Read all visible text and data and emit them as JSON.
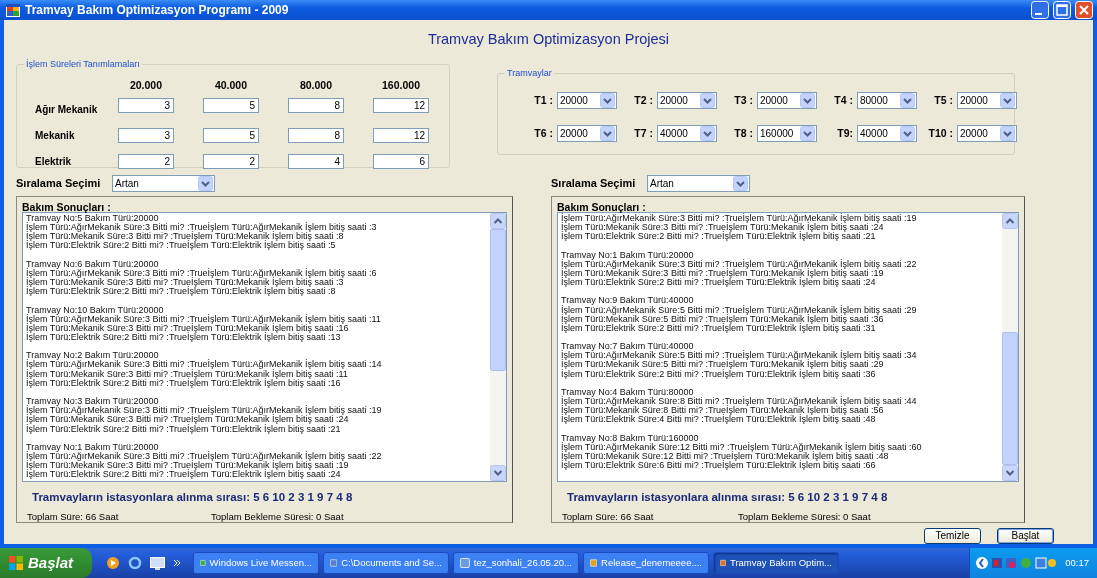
{
  "window": {
    "title": "Tramvay Bakım Optimizasyon Programı - 2009"
  },
  "heading": "Tramvay Bakım Optimizasyon Projesi",
  "durations": {
    "legend": "İşlem Süreleri  Tanımlamaları",
    "columns": [
      "20.000",
      "40.000",
      "80.000",
      "160.000"
    ],
    "rows": [
      {
        "label": "Ağır Mekanik",
        "values": [
          "3",
          "5",
          "8",
          "12"
        ]
      },
      {
        "label": "Mekanik",
        "values": [
          "3",
          "5",
          "8",
          "12"
        ]
      },
      {
        "label": "Elektrik",
        "values": [
          "2",
          "2",
          "4",
          "6"
        ]
      }
    ]
  },
  "trams": {
    "legend": "Tramvaylar",
    "items": [
      {
        "label": "T1 :",
        "value": "20000"
      },
      {
        "label": "T2 :",
        "value": "20000"
      },
      {
        "label": "T3 :",
        "value": "20000"
      },
      {
        "label": "T4 :",
        "value": "80000"
      },
      {
        "label": "T5 :",
        "value": "20000"
      },
      {
        "label": "T6 :",
        "value": "20000"
      },
      {
        "label": "T7 :",
        "value": "40000"
      },
      {
        "label": "T8 :",
        "value": "160000"
      },
      {
        "label": "T9:",
        "value": "40000"
      },
      {
        "label": "T10 :",
        "value": "20000"
      }
    ]
  },
  "panels": [
    {
      "sort_label": "Sıralama Seçimi",
      "sort_value": "Artan",
      "results_title": "Bakım Sonuçları :",
      "blocks": [
        {
          "header": "Tramvay No:5 Bakım Türü:20000",
          "lines": [
            "İşlem Türü:AğırMekanik Süre:3 Bitti mi? :Trueİşlem Türü:AğırMekanik İşlem bitiş saati :3",
            "İşlem Türü:Mekanik Süre:3 Bitti mi? :Trueİşlem Türü:Mekanik İşlem bitiş saati :8",
            "İşlem Türü:Elektrik Süre:2 Bitti mi? :Trueİşlem Türü:Elektrik İşlem bitiş saati :5"
          ]
        },
        {
          "header": "Tramvay No:6 Bakım Türü:20000",
          "lines": [
            "İşlem Türü:AğırMekanik Süre:3 Bitti mi? :Trueİşlem Türü:AğırMekanik İşlem bitiş saati :6",
            "İşlem Türü:Mekanik Süre:3 Bitti mi? :Trueİşlem Türü:Mekanik İşlem bitiş saati :3",
            "İşlem Türü:Elektrik Süre:2 Bitti mi? :Trueİşlem Türü:Elektrik İşlem bitiş saati :8"
          ]
        },
        {
          "header": "Tramvay No:10 Bakım Türü:20000",
          "lines": [
            "İşlem Türü:AğırMekanik Süre:3 Bitti mi? :Trueİşlem Türü:AğırMekanik İşlem bitiş saati :11",
            "İşlem Türü:Mekanik Süre:3 Bitti mi? :Trueİşlem Türü:Mekanik İşlem bitiş saati :16",
            "İşlem Türü:Elektrik Süre:2 Bitti mi? :Trueİşlem Türü:Elektrik İşlem bitiş saati :13"
          ]
        },
        {
          "header": "Tramvay No:2 Bakım Türü:20000",
          "lines": [
            "İşlem Türü:AğırMekanik Süre:3 Bitti mi? :Trueİşlem Türü:AğırMekanik İşlem bitiş saati :14",
            "İşlem Türü:Mekanik Süre:3 Bitti mi? :Trueİşlem Türü:Mekanik İşlem bitiş saati :11",
            "İşlem Türü:Elektrik Süre:2 Bitti mi? :Trueİşlem Türü:Elektrik İşlem bitiş saati :16"
          ]
        },
        {
          "header": "Tramvay No:3 Bakım Türü:20000",
          "lines": [
            "İşlem Türü:AğırMekanik Süre:3 Bitti mi? :Trueİşlem Türü:AğırMekanik İşlem bitiş saati :19",
            "İşlem Türü:Mekanik Süre:3 Bitti mi? :Trueİşlem Türü:Mekanik İşlem bitiş saati :24",
            "İşlem Türü:Elektrik Süre:2 Bitti mi? :Trueİşlem Türü:Elektrik İşlem bitiş saati :21"
          ]
        },
        {
          "header": "Tramvay No:1 Bakım Türü:20000",
          "lines": [
            "İşlem Türü:AğırMekanik Süre:3 Bitti mi? :Trueİşlem Türü:AğırMekanik İşlem bitiş saati :22",
            "İşlem Türü:Mekanik Süre:3 Bitti mi? :Trueİşlem Türü:Mekanik İşlem bitiş saati :19",
            "İşlem Türü:Elektrik Süre:2 Bitti mi? :Trueİşlem Türü:Elektrik İşlem bitiş saati :24"
          ]
        }
      ],
      "order": "Tramvayların istasyonlara alınma sırası: 5 6 10 2 3 1 9 7 4 8",
      "total": "Toplam Süre: 66 Saat",
      "wait": "Toplam Bekleme Süresi: 0 Saat"
    },
    {
      "sort_label": "Sıralama Seçimi",
      "sort_value": "Artan",
      "results_title": "Bakım Sonuçları :",
      "blocks": [
        {
          "lines": [
            "İşlem Türü:AğırMekanik Süre:3 Bitti mi? :Trueİşlem Türü:AğırMekanik İşlem bitiş saati :19",
            "İşlem Türü:Mekanik Süre:3 Bitti mi? :Trueİşlem Türü:Mekanik İşlem bitiş saati :24",
            "İşlem Türü:Elektrik Süre:2 Bitti mi? :Trueİşlem Türü:Elektrik İşlem bitiş saati :21"
          ]
        },
        {
          "header": "Tramvay No:1 Bakım Türü:20000",
          "lines": [
            "İşlem Türü:AğırMekanik Süre:3 Bitti mi? :Trueİşlem Türü:AğırMekanik İşlem bitiş saati :22",
            "İşlem Türü:Mekanik Süre:3 Bitti mi? :Trueİşlem Türü:Mekanik İşlem bitiş saati :19",
            "İşlem Türü:Elektrik Süre:2 Bitti mi? :Trueİşlem Türü:Elektrik İşlem bitiş saati :24"
          ]
        },
        {
          "header": "Tramvay No:9 Bakım Türü:40000",
          "lines": [
            "İşlem Türü:AğırMekanik Süre:5 Bitti mi? :Trueİşlem Türü:AğırMekanik İşlem bitiş saati :29",
            "İşlem Türü:Mekanik Süre:5 Bitti mi? :Trueİşlem Türü:Mekanik İşlem bitiş saati :36",
            "İşlem Türü:Elektrik Süre:2 Bitti mi? :Trueİşlem Türü:Elektrik İşlem bitiş saati :31"
          ]
        },
        {
          "header": "Tramvay No:7 Bakım Türü:40000",
          "lines": [
            "İşlem Türü:AğırMekanik Süre:5 Bitti mi? :Trueİşlem Türü:AğırMekanik İşlem bitiş saati :34",
            "İşlem Türü:Mekanik Süre:5 Bitti mi? :Trueİşlem Türü:Mekanik İşlem bitiş saati :29",
            "İşlem Türü:Elektrik Süre:2 Bitti mi? :Trueİşlem Türü:Elektrik İşlem bitiş saati :36"
          ]
        },
        {
          "header": "Tramvay No:4 Bakım Türü:80000",
          "lines": [
            "İşlem Türü:AğırMekanik Süre:8 Bitti mi? :Trueİşlem Türü:AğırMekanik İşlem bitiş saati :44",
            "İşlem Türü:Mekanik Süre:8 Bitti mi? :Trueİşlem Türü:Mekanik İşlem bitiş saati :56",
            "İşlem Türü:Elektrik Süre:4 Bitti mi? :Trueİşlem Türü:Elektrik İşlem bitiş saati :48"
          ]
        },
        {
          "header": "Tramvay No:8 Bakım Türü:160000",
          "lines": [
            "İşlem Türü:AğırMekanik Süre:12 Bitti mi? :Trueİşlem Türü:AğırMekanik İşlem bitiş saati :60",
            "İşlem Türü:Mekanik Süre:12 Bitti mi? :Trueİşlem Türü:Mekanik İşlem bitiş saati :48",
            "İşlem Türü:Elektrik Süre:6 Bitti mi? :Trueİşlem Türü:Elektrik İşlem bitiş saati :66"
          ]
        }
      ],
      "order": "Tramvayların istasyonlara alınma sırası: 5 6 10 2 3 1 9 7 4 8",
      "total": "Toplam Süre: 66 Saat",
      "wait": "Toplam Bekleme Süresi: 0 Saat"
    }
  ],
  "buttons": [
    {
      "label": "Temizle",
      "focused": false
    },
    {
      "label": "Başlat",
      "focused": true
    }
  ],
  "taskbar": {
    "start": "Başlat",
    "tasks": [
      {
        "label": "Windows Live Messen...",
        "selected": false
      },
      {
        "label": "C:\\Documents and Se...",
        "selected": false
      },
      {
        "label": "tez_sonhali_26.05.20...",
        "selected": false
      },
      {
        "label": "Release_denemeeee....",
        "selected": false
      },
      {
        "label": "Tramvay Bakım Optim...",
        "selected": true
      }
    ],
    "clock": "00:17"
  }
}
